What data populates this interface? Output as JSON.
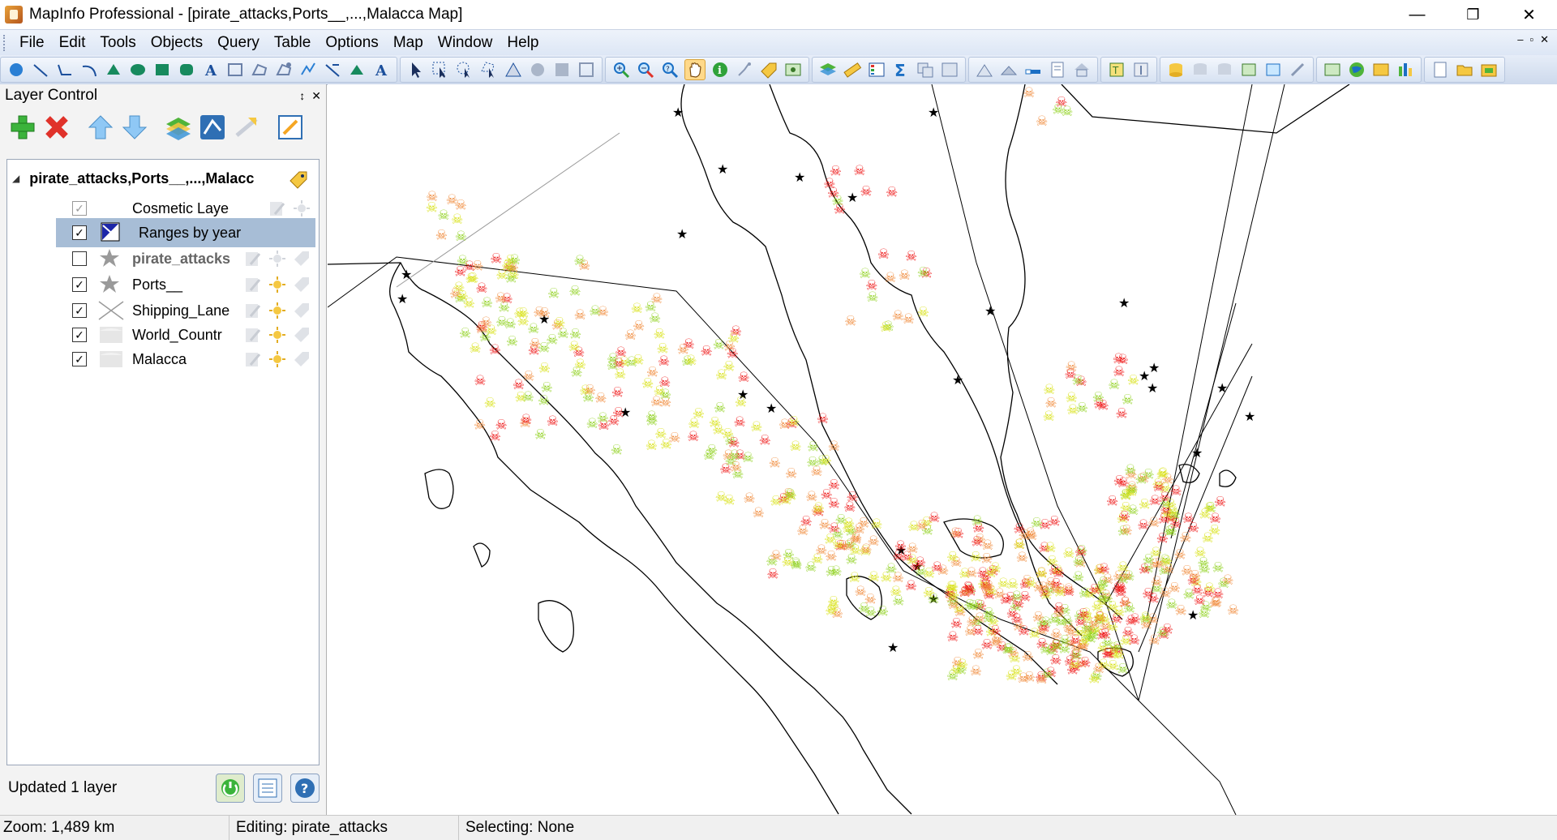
{
  "window": {
    "title": "MapInfo Professional - [pirate_attacks,Ports__,...,Malacca Map]",
    "minimize": "—",
    "restore": "❐",
    "close": "✕"
  },
  "menu": {
    "items": [
      "File",
      "Edit",
      "Tools",
      "Objects",
      "Query",
      "Table",
      "Options",
      "Map",
      "Window",
      "Help"
    ],
    "mdi_controls": [
      "–",
      "▫",
      "✕"
    ]
  },
  "layer_control": {
    "title": "Layer Control",
    "pin": "↕",
    "close": "✕",
    "root_label": "pirate_attacks,Ports__,...,Malacc",
    "layers": [
      {
        "name": "Cosmetic Laye",
        "checked": true,
        "icon": "cosmetic-icon"
      },
      {
        "name": "Ranges by year",
        "checked": true,
        "icon": "thematic-range-icon"
      },
      {
        "name": "pirate_attacks",
        "checked": false,
        "icon": "star-icon"
      },
      {
        "name": "Ports__",
        "checked": true,
        "icon": "star-icon"
      },
      {
        "name": "Shipping_Lane",
        "checked": true,
        "icon": "line-icon"
      },
      {
        "name": "World_Countr",
        "checked": true,
        "icon": "region-icon"
      },
      {
        "name": "Malacca",
        "checked": true,
        "icon": "region-icon"
      }
    ],
    "status": "Updated 1 layer"
  },
  "statusbar": {
    "zoom": "Zoom: 1,489 km",
    "editing": "Editing: pirate_attacks",
    "selecting": "Selecting: None"
  },
  "colors": {
    "accent_selected": "#a7bdd6",
    "attack_red": "#ee1111",
    "attack_orange": "#f08a3a",
    "attack_yellow": "#d9e21a",
    "attack_green": "#8fd11e",
    "port_black": "#000000"
  },
  "map_symbols": {
    "ports": "★",
    "attacks": "☠"
  }
}
